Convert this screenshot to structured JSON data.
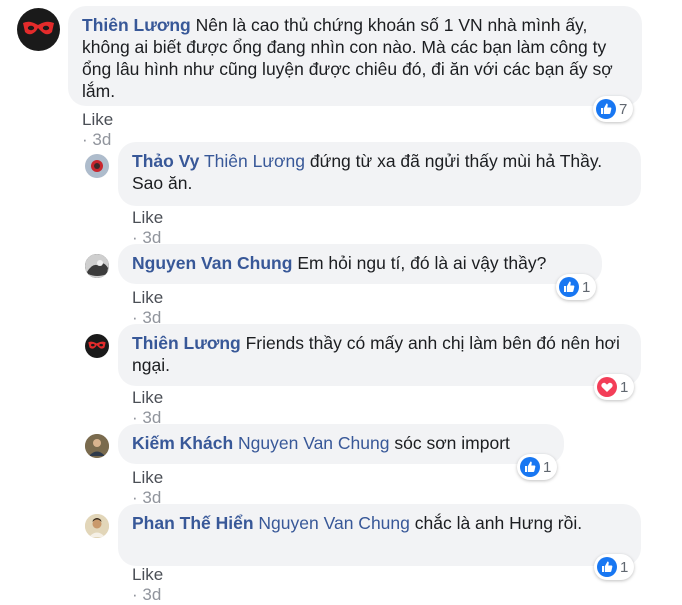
{
  "meta_sep": "·",
  "comments": [
    {
      "author": "Thiên Lương",
      "tag": "",
      "text": "Nên là cao thủ chứng khoán số 1 VN nhà mình ấy, không ai biết được ổng đang nhìn con nào. Mà các bạn làm công ty ổng lâu hình như cũng luyện được chiêu đó, đi ăn với các bạn ấy sợ lắm.",
      "like_label": "Like",
      "time": "3d",
      "reaction": "like",
      "reaction_count": "7"
    },
    {
      "author": "Thảo Vy",
      "tag": "Thiên Lương",
      "text": "đứng từ xa đã ngửi thấy mùi hả Thầy. Sao ăn.",
      "like_label": "Like",
      "time": "3d",
      "reaction": "",
      "reaction_count": ""
    },
    {
      "author": "Nguyen Van Chung",
      "tag": "",
      "text": "Em hỏi ngu tí, đó là ai vậy thầy?",
      "like_label": "Like",
      "time": "3d",
      "reaction": "like",
      "reaction_count": "1"
    },
    {
      "author": "Thiên Lương",
      "tag": "",
      "text": "Friends thầy có mấy anh chị làm bên đó nên hơi ngại.",
      "like_label": "Like",
      "time": "3d",
      "reaction": "love",
      "reaction_count": "1"
    },
    {
      "author": "Kiếm Khách",
      "tag": "Nguyen Van Chung",
      "text": "sóc sơn import",
      "like_label": "Like",
      "time": "3d",
      "reaction": "like",
      "reaction_count": "1"
    },
    {
      "author": "Phan Thế Hiển",
      "tag": "Nguyen Van Chung",
      "text": "chắc là anh Hưng rồi.",
      "like_label": "Like",
      "time": "3d",
      "reaction": "like",
      "reaction_count": "1"
    }
  ],
  "colors": {
    "name": "#385898",
    "bubble": "#f2f3f5",
    "like_blue": "#1877f2",
    "love_red": "#f33e58"
  }
}
